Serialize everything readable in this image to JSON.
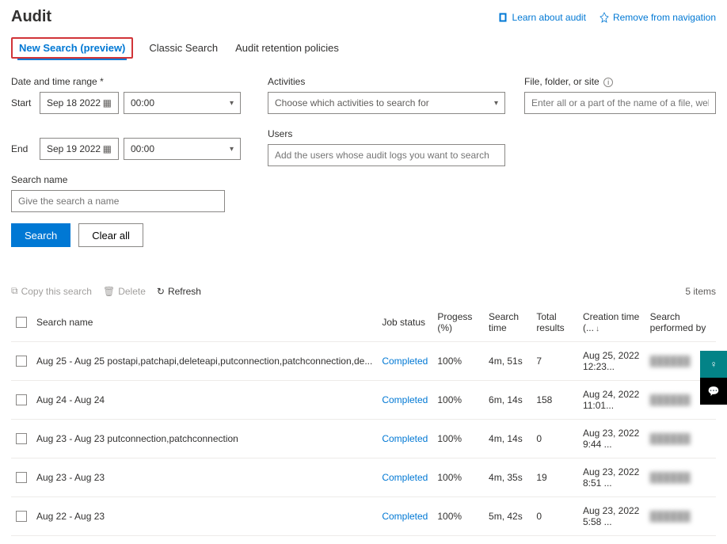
{
  "header": {
    "title": "Audit",
    "links": [
      {
        "label": "Learn about audit"
      },
      {
        "label": "Remove from navigation"
      }
    ]
  },
  "tabs": [
    {
      "label": "New Search (preview)",
      "active": true,
      "highlighted": true
    },
    {
      "label": "Classic Search"
    },
    {
      "label": "Audit retention policies"
    }
  ],
  "form": {
    "dateRangeLabel": "Date and time range *",
    "startLabel": "Start",
    "startDate": "Sep 18 2022",
    "startTime": "00:00",
    "endLabel": "End",
    "endDate": "Sep 19 2022",
    "endTime": "00:00",
    "searchNameLabel": "Search name",
    "searchNamePlaceholder": "Give the search a name",
    "activitiesLabel": "Activities",
    "activitiesPlaceholder": "Choose which activities to search for",
    "usersLabel": "Users",
    "usersPlaceholder": "Add the users whose audit logs you want to search",
    "fileLabel": "File, folder, or site",
    "filePlaceholder": "Enter all or a part of the name of a file, website, or folder",
    "searchBtn": "Search",
    "clearBtn": "Clear all"
  },
  "toolbar": {
    "copy": "Copy this search",
    "delete": "Delete",
    "refresh": "Refresh",
    "itemCount": "5 items"
  },
  "table": {
    "headers": {
      "search": "Search name",
      "status": "Job status",
      "progress": "Progess (%)",
      "time": "Search time",
      "results": "Total results",
      "creation": "Creation time (...",
      "performed": "Search performed by"
    },
    "rows": [
      {
        "search": "Aug 25 - Aug 25 postapi,patchapi,deleteapi,putconnection,patchconnection,de...",
        "status": "Completed",
        "progress": "100%",
        "time": "4m, 51s",
        "results": "7",
        "creation": "Aug 25, 2022 12:23...",
        "performed": "██████"
      },
      {
        "search": "Aug 24 - Aug 24",
        "status": "Completed",
        "progress": "100%",
        "time": "6m, 14s",
        "results": "158",
        "creation": "Aug 24, 2022 11:01...",
        "performed": "██████"
      },
      {
        "search": "Aug 23 - Aug 23 putconnection,patchconnection",
        "status": "Completed",
        "progress": "100%",
        "time": "4m, 14s",
        "results": "0",
        "creation": "Aug 23, 2022 9:44 ...",
        "performed": "██████"
      },
      {
        "search": "Aug 23 - Aug 23",
        "status": "Completed",
        "progress": "100%",
        "time": "4m, 35s",
        "results": "19",
        "creation": "Aug 23, 2022 8:51 ...",
        "performed": "██████"
      },
      {
        "search": "Aug 22 - Aug 23",
        "status": "Completed",
        "progress": "100%",
        "time": "5m, 42s",
        "results": "0",
        "creation": "Aug 23, 2022 5:58 ...",
        "performed": "██████"
      }
    ]
  }
}
